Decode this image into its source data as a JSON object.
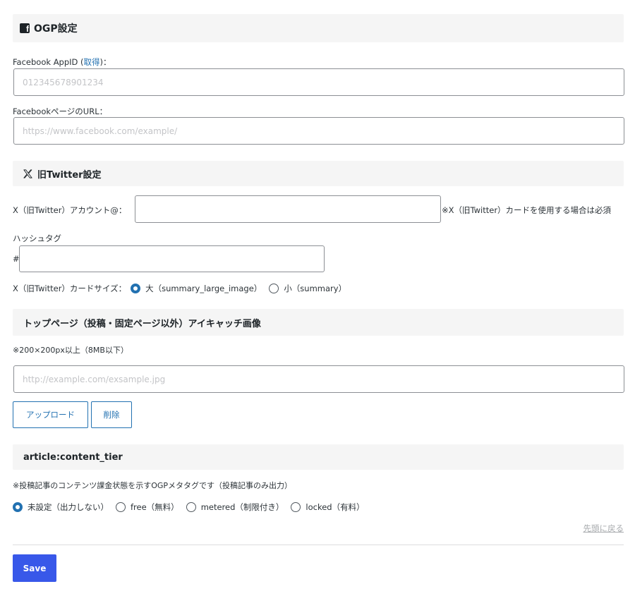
{
  "ogp": {
    "title": "OGP設定",
    "app_id_label": "Facebook AppID (",
    "app_id_link": "取得",
    "app_id_label_end": ")：",
    "app_id_placeholder": "012345678901234",
    "page_url_label": "FacebookページのURL：",
    "page_url_placeholder": "https://www.facebook.com/example/"
  },
  "twitter": {
    "title": "旧Twitter設定",
    "account_label": "X（旧Twitter）アカウント@：",
    "account_note": "※X（旧Twitter）カードを使用する場合は必須",
    "hashtag_label": "ハッシュタグ",
    "hashtag_prefix": "#",
    "card_size_label": "X（旧Twitter）カードサイズ：",
    "card_size_options": [
      "大（summary_large_image）",
      "小（summary）"
    ],
    "card_size_selected": 0
  },
  "eyecatch": {
    "title": "トップページ（投稿・固定ページ以外）アイキャッチ画像",
    "note": "※200×200px以上（8MB以下）",
    "placeholder": "http://example.com/exsample.jpg",
    "upload_label": "アップロード",
    "delete_label": "削除"
  },
  "content_tier": {
    "title": "article:content_tier",
    "note": "※投稿記事のコンテンツ課金状態を示すOGPメタタグです（投稿記事のみ出力）",
    "options": [
      "未設定（出力しない）",
      "free（無料）",
      "metered（制限付き）",
      "locked（有料）"
    ],
    "selected": 0
  },
  "back_to_top": "先頭に戻る",
  "save_label": "Save",
  "colors": {
    "accent": "#2271b1",
    "primary_button": "#3858e9",
    "section_bg": "#f5f5f5"
  },
  "icons": {
    "ogp": "facebook-icon",
    "twitter": "x-logo-icon"
  }
}
